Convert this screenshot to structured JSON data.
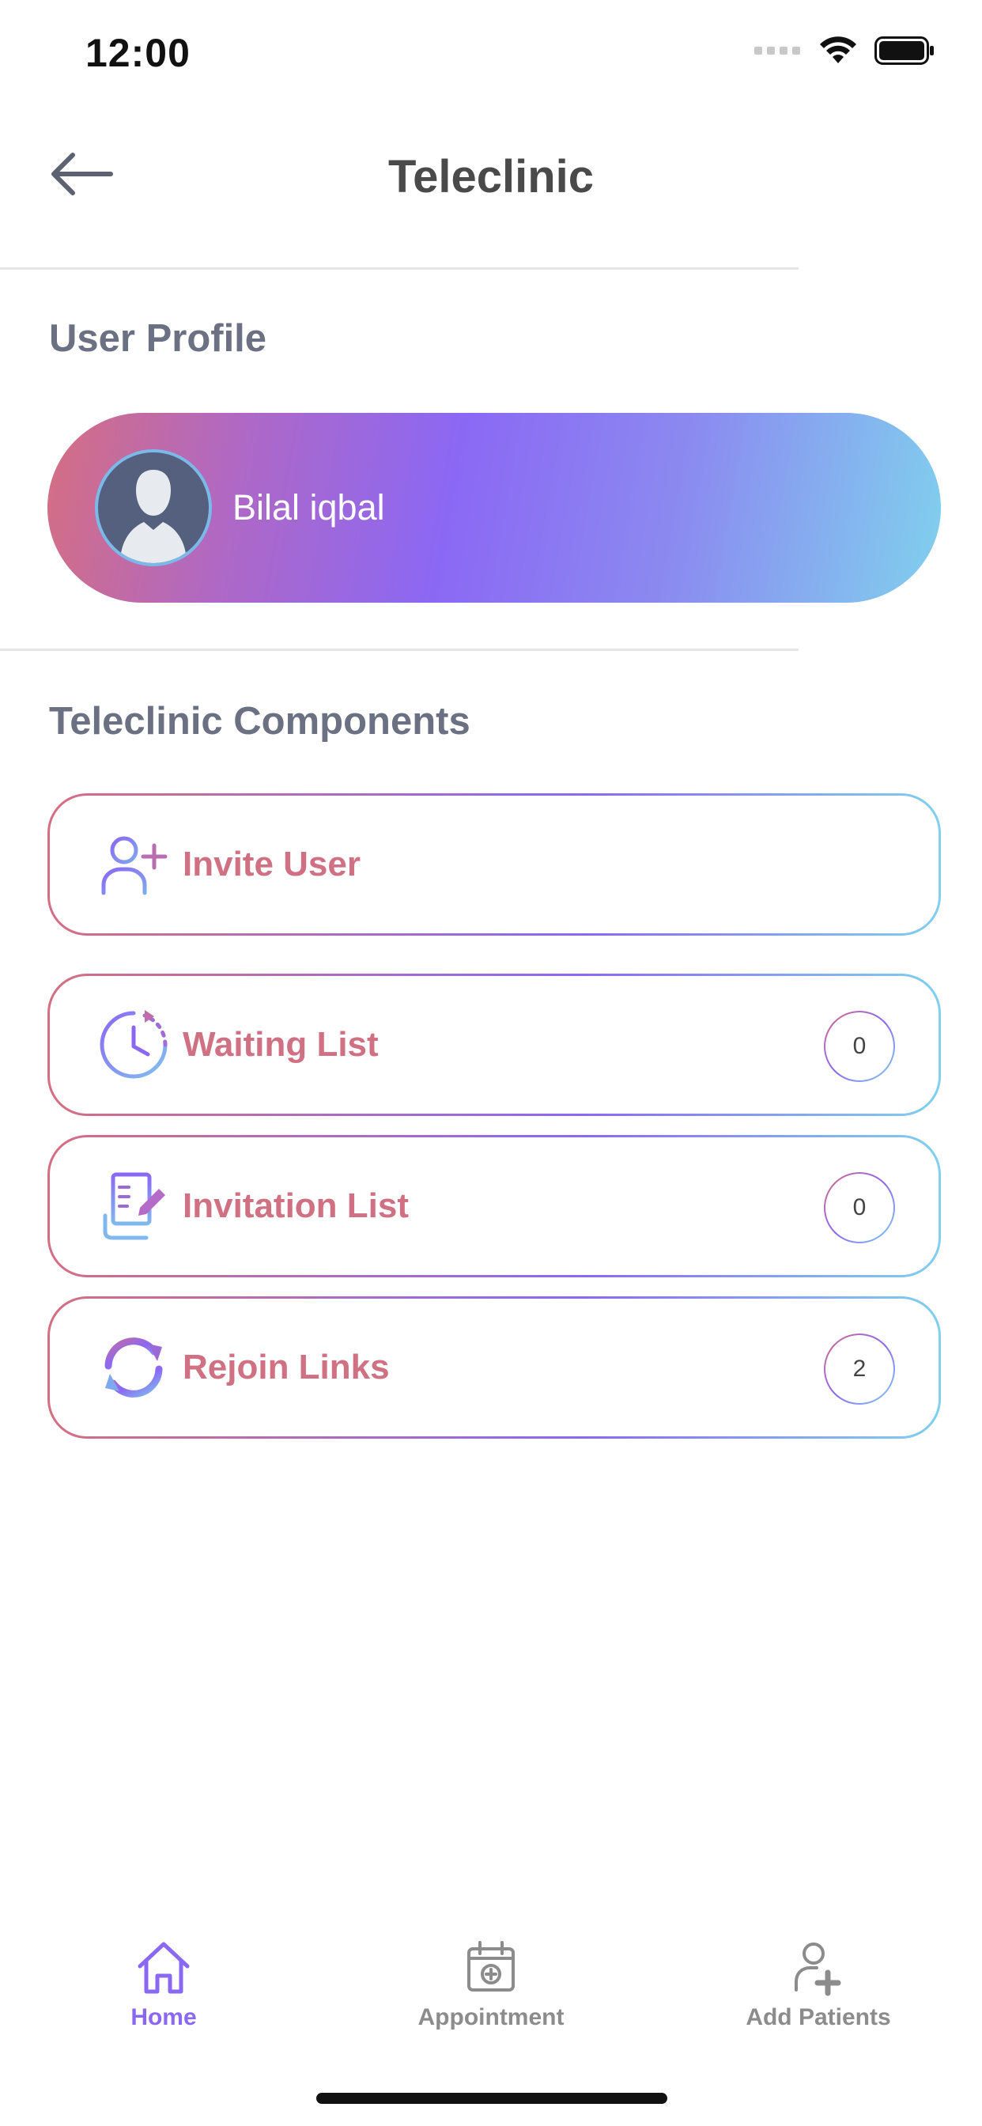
{
  "status_bar": {
    "time": "12:00"
  },
  "header": {
    "title": "Teleclinic"
  },
  "profile_section": {
    "title": "User Profile",
    "user_name": "Bilal iqbal"
  },
  "components_section": {
    "title": "Teleclinic Components",
    "items": [
      {
        "label": "Invite User",
        "icon": "add-user-icon"
      },
      {
        "label": "Waiting List",
        "icon": "clock-icon",
        "count": "0"
      },
      {
        "label": "Invitation List",
        "icon": "document-edit-icon",
        "count": "0"
      },
      {
        "label": "Rejoin Links",
        "icon": "refresh-icon",
        "count": "2"
      }
    ]
  },
  "bottom_nav": {
    "tabs": [
      {
        "label": "Home",
        "icon": "home-icon",
        "active": true
      },
      {
        "label": "Appointment",
        "icon": "calendar-icon",
        "active": false
      },
      {
        "label": "Add Patients",
        "icon": "add-patient-icon",
        "active": false
      }
    ]
  },
  "colors": {
    "accent_purple": "#8b68f4",
    "accent_pink": "#d56e82",
    "accent_cyan": "#80d0ee",
    "row_label": "#d07083",
    "section_title": "#6b7082"
  }
}
